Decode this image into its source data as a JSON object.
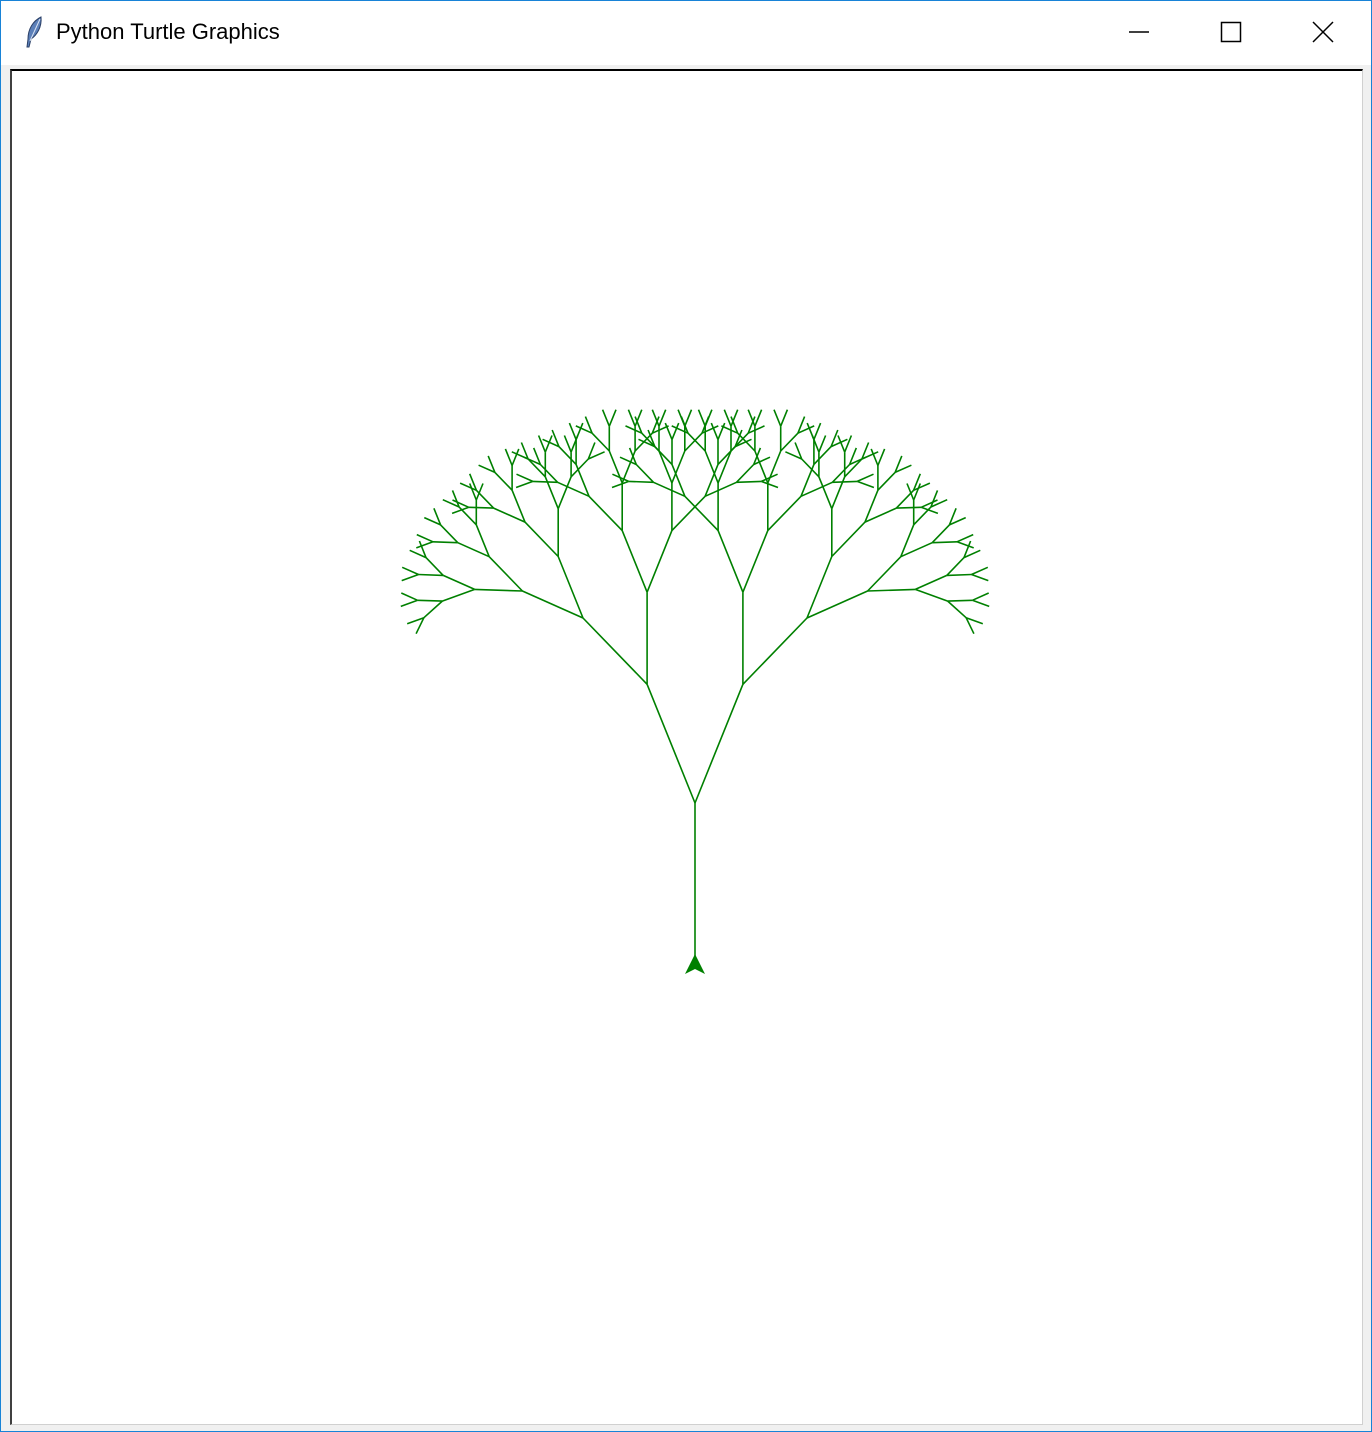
{
  "window": {
    "title": "Python Turtle Graphics",
    "accent_color": "#1883d7"
  },
  "titlebar": {
    "icons": {
      "app": "feather-icon",
      "minimize": "minimize-icon",
      "maximize": "maximize-icon",
      "close": "close-icon"
    }
  },
  "canvas": {
    "background": "#ffffff",
    "pen_color": "#008000",
    "drawing": "fractal-tree",
    "turtle_icon": "turtle-arrow-icon"
  }
}
